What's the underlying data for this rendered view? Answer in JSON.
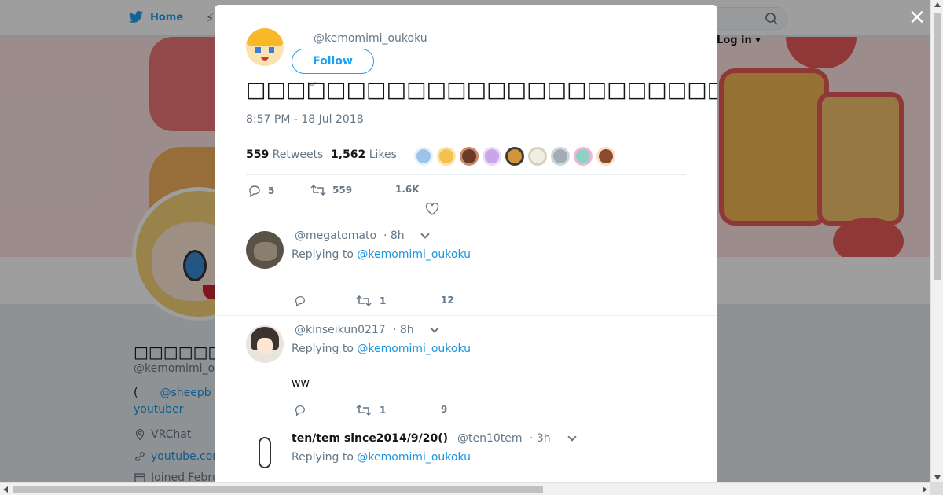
{
  "nav": {
    "home_label": "Home",
    "login_label": "Log in ▾"
  },
  "profile": {
    "name": "□□□□□□□□□□□",
    "handle": "@kemomimi_o",
    "bio_prefix": "(",
    "bio_mention": "@sheepb",
    "bio_line2": "youtuber",
    "location": "VRChat",
    "url": "youtube.cor",
    "joined": "Joined Febru"
  },
  "tweet": {
    "handle": "@kemomimi_oukoku",
    "follow_label": "Follow",
    "text": "□□□□□□□□□□□□□□□□□□□□□□□□□□VRChat□□□□□□□□□□□□□□□□□□□□□□□□□□□□□",
    "timestamp": "8:57 PM - 18 Jul 2018",
    "retweets_count": "559",
    "retweets_label": "Retweets",
    "likes_count": "1,562",
    "likes_label": "Likes",
    "reply_count": "5",
    "retweet_count": "559",
    "like_count": "1.6K"
  },
  "replies": [
    {
      "name": "",
      "handle": "@megatomato",
      "time": "· 8h",
      "replying_prefix": "Replying to",
      "replying_to": "@kemomimi_oukoku",
      "body": "",
      "retweets": "1",
      "likes": "12"
    },
    {
      "name": "",
      "handle": "@kinseikun0217",
      "time": "· 8h",
      "replying_prefix": "Replying to",
      "replying_to": "@kemomimi_oukoku",
      "body": "ww",
      "retweets": "1",
      "likes": "9"
    },
    {
      "name": "ten/tem since2014/9/20()",
      "handle": "@ten10tem",
      "time": "· 3h",
      "replying_prefix": "Replying to",
      "replying_to": "@kemomimi_oukoku",
      "body": "",
      "retweets": "",
      "likes": ""
    }
  ],
  "colors": {
    "accent": "#1da1f2",
    "link": "#1b95e0",
    "muted": "#657786"
  }
}
